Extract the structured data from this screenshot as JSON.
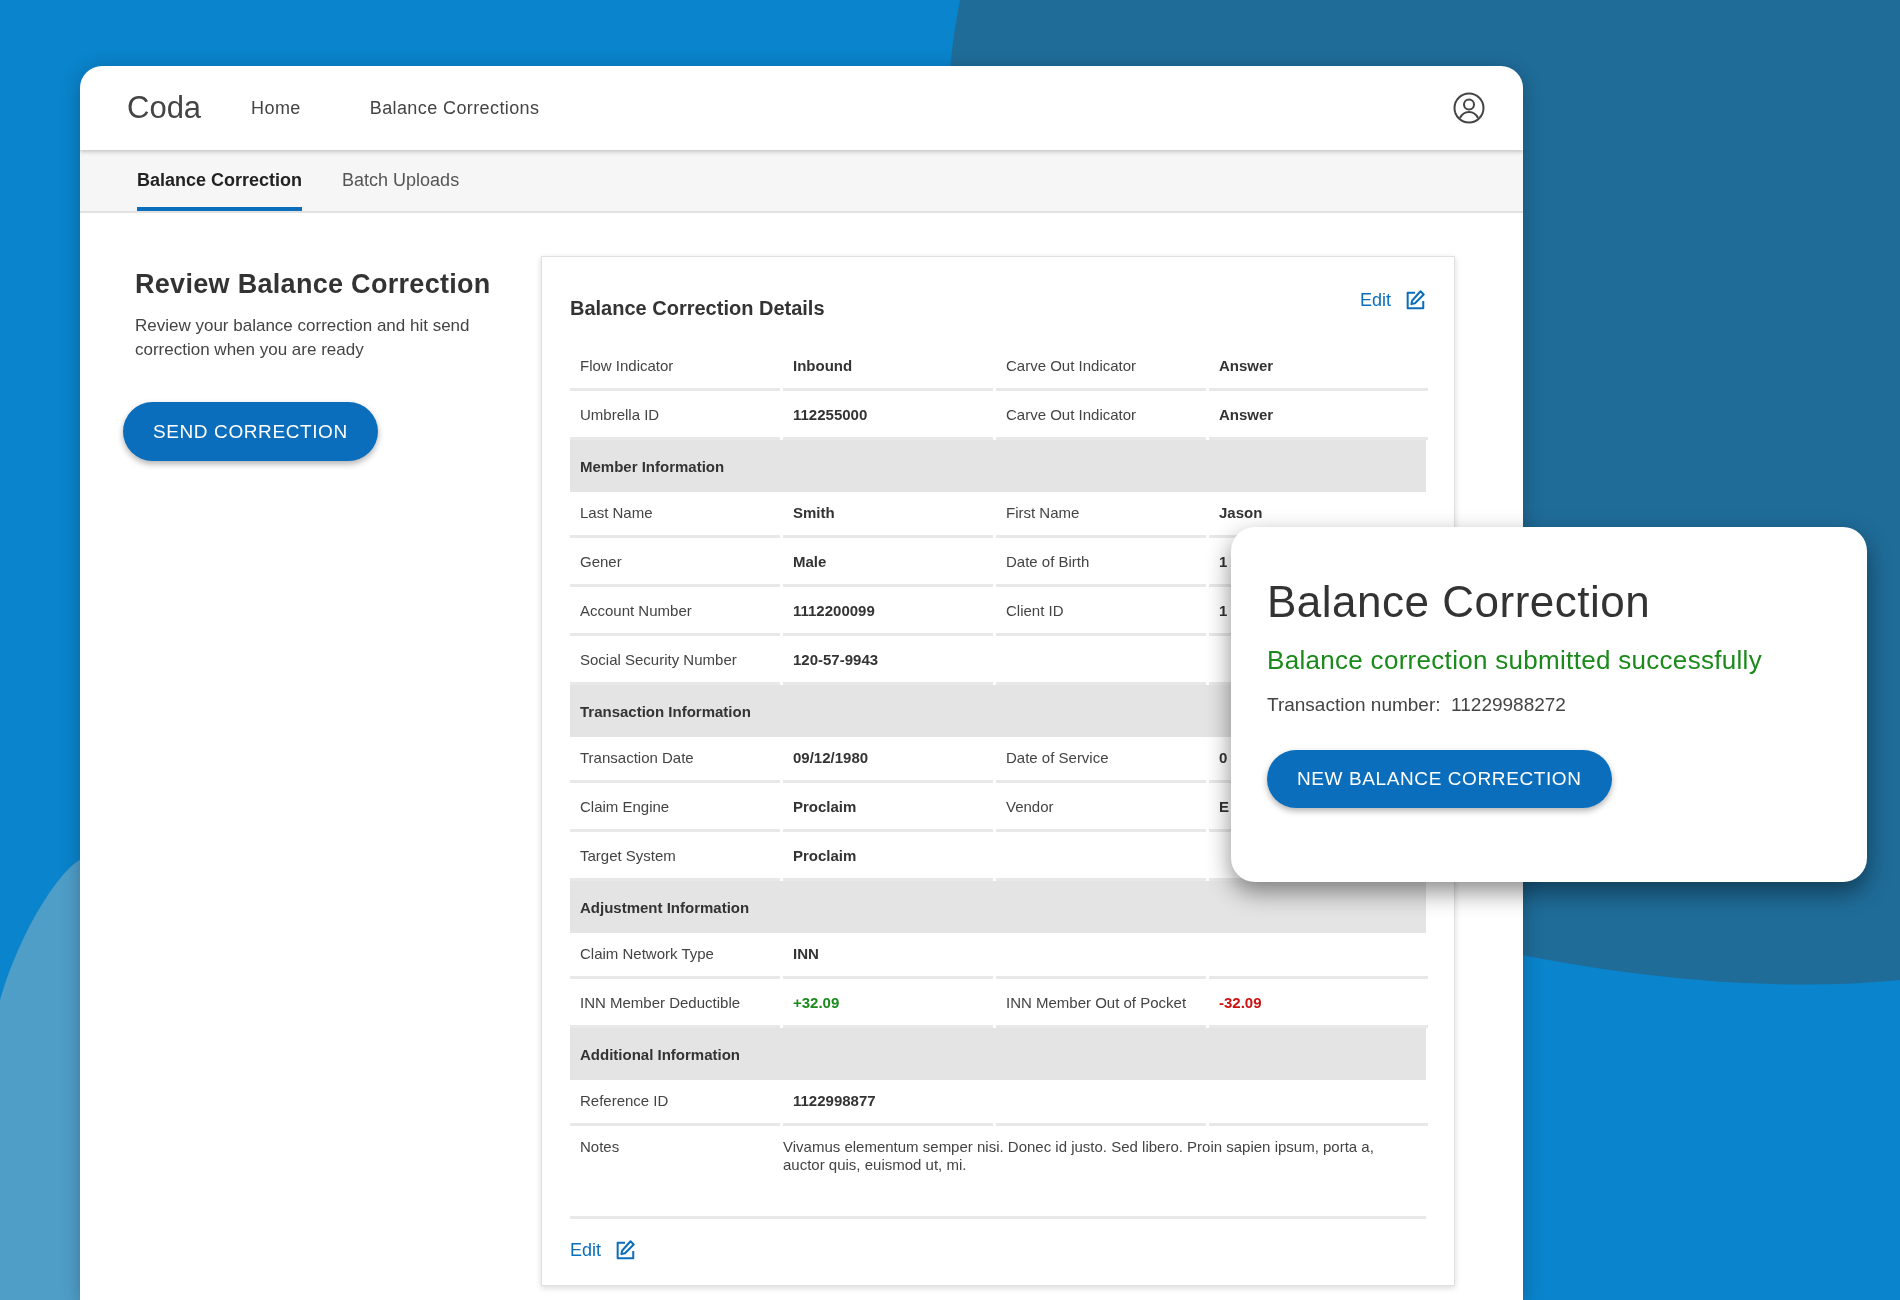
{
  "app": {
    "logo": "Coda",
    "nav": [
      {
        "label": "Home"
      },
      {
        "label": "Balance Corrections"
      }
    ]
  },
  "tabs": [
    {
      "label": "Balance Correction",
      "selected": true
    },
    {
      "label": "Batch Uploads",
      "selected": false
    }
  ],
  "intro": {
    "title": "Review Balance Correction",
    "description": "Review your balance correction and hit send correction when you are ready",
    "button": "SEND CORRECTION"
  },
  "details": {
    "title": "Balance Correction Details",
    "edit_top": "Edit",
    "edit_bottom": "Edit",
    "rows": [
      {
        "kind": "field",
        "fields": [
          {
            "label": "Flow Indicator",
            "value": "Inbound"
          },
          {
            "label": "Carve Out Indicator",
            "value": "Answer"
          }
        ]
      },
      {
        "kind": "field",
        "fields": [
          {
            "label": "Umbrella ID",
            "value": "112255000"
          },
          {
            "label": "Carve Out Indicator",
            "value": "Answer"
          }
        ]
      },
      {
        "kind": "section",
        "label": "Member Information"
      },
      {
        "kind": "field",
        "fields": [
          {
            "label": "Last Name",
            "value": "Smith"
          },
          {
            "label": "First Name",
            "value": "Jason"
          }
        ]
      },
      {
        "kind": "field",
        "fields": [
          {
            "label": "Gener",
            "value": "Male"
          },
          {
            "label": "Date of Birth",
            "value": "1"
          }
        ]
      },
      {
        "kind": "field",
        "fields": [
          {
            "label": "Account Number",
            "value": "1112200099"
          },
          {
            "label": "Client ID",
            "value": "1"
          }
        ]
      },
      {
        "kind": "field",
        "fields": [
          {
            "label": "Social Security Number",
            "value": "120-57-9943"
          }
        ]
      },
      {
        "kind": "section",
        "label": "Transaction Information"
      },
      {
        "kind": "field",
        "fields": [
          {
            "label": "Transaction Date",
            "value": "09/12/1980"
          },
          {
            "label": "Date of Service",
            "value": "0"
          }
        ]
      },
      {
        "kind": "field",
        "fields": [
          {
            "label": "Claim Engine",
            "value": "Proclaim"
          },
          {
            "label": "Vendor",
            "value": "E"
          }
        ]
      },
      {
        "kind": "field",
        "fields": [
          {
            "label": "Target System",
            "value": "Proclaim"
          }
        ]
      },
      {
        "kind": "section",
        "label": "Adjustment Information"
      },
      {
        "kind": "field",
        "fields": [
          {
            "label": "Claim Network Type",
            "value": "INN"
          }
        ]
      },
      {
        "kind": "field",
        "fields": [
          {
            "label": "INN Member Deductible",
            "value": "+32.09",
            "color": "#1a8a1a"
          },
          {
            "label": "INN Member Out of Pocket",
            "value": "-32.09",
            "color": "#cc1111"
          }
        ]
      },
      {
        "kind": "section",
        "label": "Additional Information"
      },
      {
        "kind": "field",
        "fields": [
          {
            "label": "Reference ID",
            "value": "1122998877"
          }
        ]
      },
      {
        "kind": "notes",
        "label": "Notes",
        "value": "Vivamus elementum semper nisi. Donec id justo. Sed libero. Proin sapien ipsum, porta a, auctor quis, euismod ut, mi."
      }
    ]
  },
  "dialog": {
    "title": "Balance Correction",
    "message": "Balance correction submitted successfully",
    "transaction_label": "Transaction number:",
    "transaction_number": "11229988272",
    "button": "NEW BALANCE CORRECTION"
  }
}
